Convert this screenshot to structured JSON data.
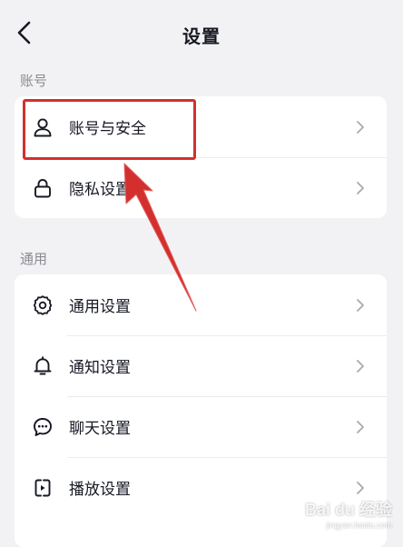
{
  "header": {
    "title": "设置",
    "back_icon": "chevron-left-icon"
  },
  "sections": [
    {
      "label": "账号",
      "items": [
        {
          "label": "账号与安全",
          "icon": "user-icon"
        },
        {
          "label": "隐私设置",
          "icon": "lock-icon"
        }
      ]
    },
    {
      "label": "通用",
      "items": [
        {
          "label": "通用设置",
          "icon": "gear-icon"
        },
        {
          "label": "通知设置",
          "icon": "bell-icon"
        },
        {
          "label": "聊天设置",
          "icon": "chat-icon"
        },
        {
          "label": "播放设置",
          "icon": "play-icon"
        }
      ]
    }
  ],
  "annotation": {
    "color": "#d32f2f",
    "target": "账号与安全"
  },
  "watermark": {
    "main": "Bai du 经验",
    "sub": "jingyan.baidu.com"
  },
  "colors": {
    "background": "#f2f2f4",
    "card": "#ffffff",
    "text": "#161823",
    "secondary_text": "#8a8b91",
    "chevron": "#a8a9ae"
  }
}
